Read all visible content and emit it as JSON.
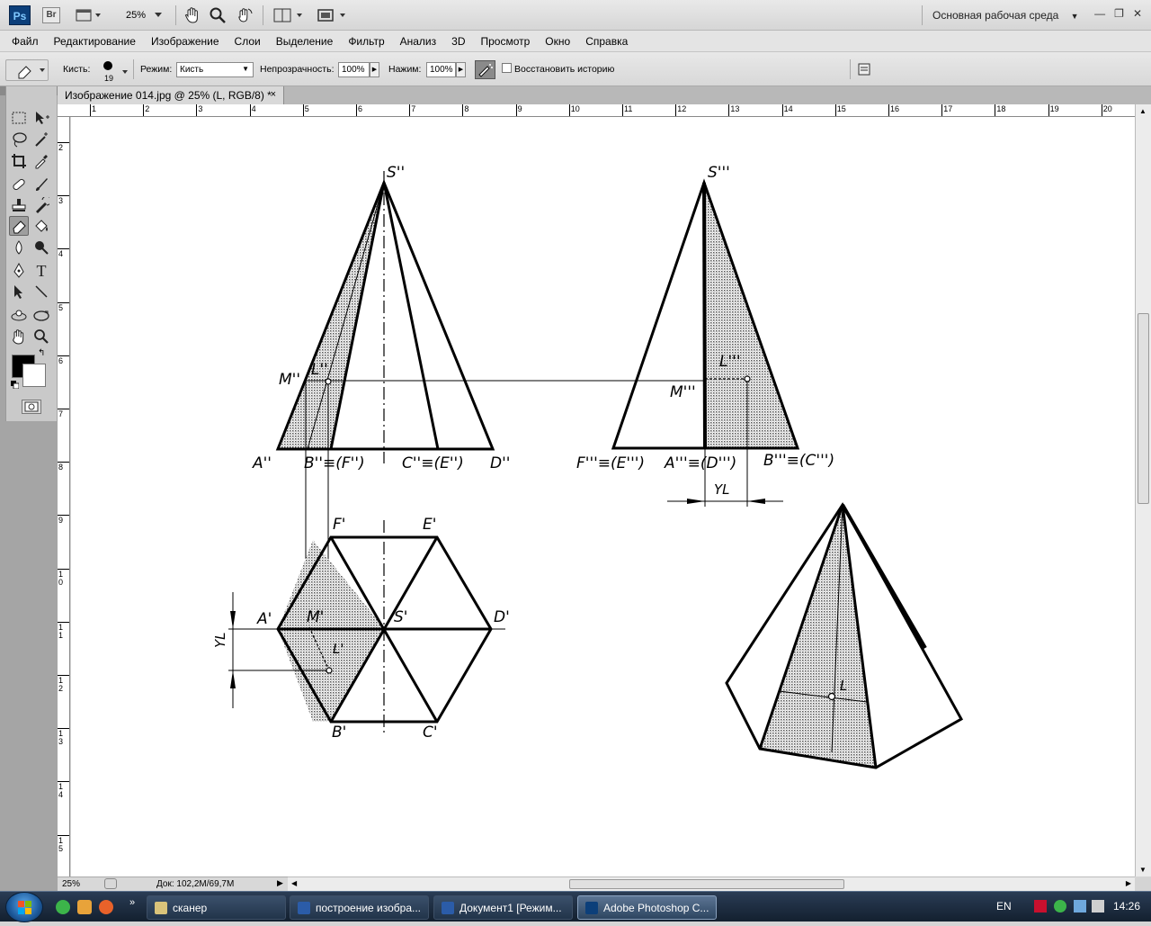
{
  "app": {
    "logo": "Ps",
    "bridge": "Br",
    "zoom_value": "25%",
    "workspace": "Основная рабочая среда"
  },
  "menu": [
    "Файл",
    "Редактирование",
    "Изображение",
    "Слои",
    "Выделение",
    "Фильтр",
    "Анализ",
    "3D",
    "Просмотр",
    "Окно",
    "Справка"
  ],
  "options": {
    "brush_label": "Кисть:",
    "brush_size": "19",
    "mode_label": "Режим:",
    "mode_value": "Кисть",
    "opacity_label": "Непрозрачность:",
    "opacity_value": "100%",
    "pressure_label": "Нажим:",
    "pressure_value": "100%",
    "history_label": "Восстановить историю"
  },
  "document": {
    "tab_title": "Изображение 014.jpg @ 25% (L, RGB/8) *",
    "close": "×"
  },
  "ruler": {
    "h_labels": [
      "1",
      "2",
      "3",
      "4",
      "5",
      "6",
      "7",
      "8",
      "9",
      "10",
      "11",
      "12",
      "13",
      "14",
      "15",
      "16",
      "17",
      "18",
      "19",
      "20"
    ],
    "v_labels": [
      "2",
      "3",
      "4",
      "5",
      "6",
      "7",
      "8",
      "9",
      "10",
      "11",
      "12",
      "13",
      "14",
      "15"
    ]
  },
  "drawing": {
    "labels": {
      "s2": "S''",
      "s3": "S'''",
      "m2": "M''",
      "l2": "L''",
      "m3": "M'''",
      "l3": "L'''",
      "a2": "A''",
      "b2f2": "B''≡(F'')",
      "c2e2": "C''≡(E'')",
      "d2": "D''",
      "f3e3": "F'''≡(E''')",
      "a3d3": "A'''≡(D''')",
      "b3c3": "B'''≡(C''')",
      "yl_top": "YL",
      "f1": "F'",
      "e1": "E'",
      "a1": "A'",
      "m1": "M'",
      "s1": "S'",
      "d1": "D'",
      "l1": "L'",
      "b1": "B'",
      "c1": "C'",
      "yl_side": "YL",
      "l_iso": "L"
    }
  },
  "status": {
    "zoom": "25%",
    "doc_info": "Док: 102,2M/69,7M"
  },
  "taskbar": {
    "tasks": [
      "сканер",
      "построение изобра...",
      "Документ1 [Режим...",
      "Adobe Photoshop C..."
    ],
    "lang": "EN",
    "time": "14:26"
  }
}
